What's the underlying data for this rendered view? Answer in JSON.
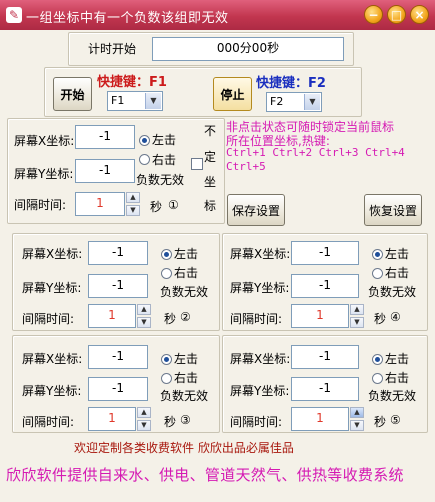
{
  "window": {
    "title": "一组坐标中有一个负数该组即无效",
    "app_icon": "✎",
    "minimize": "−",
    "maximize": "□",
    "close": "×"
  },
  "timer": {
    "label": "计时开始",
    "value": "000分00秒"
  },
  "controls": {
    "start_label": "开始",
    "start_hotkey_label": "快捷键：F1",
    "start_hotkey_value": "F1",
    "stop_label": "停止",
    "stop_hotkey_label": "快捷键：F2",
    "stop_hotkey_value": "F2"
  },
  "hint": {
    "line1": "非点击状态可随时锁定当前鼠标",
    "line2": "所在位置坐标,热键:",
    "line3": "Ctrl+1 Ctrl+2 Ctrl+3 Ctrl+4",
    "line4": "Ctrl+5"
  },
  "labels": {
    "x": "屏幕X坐标:",
    "y": "屏幕Y坐标:",
    "interval": "间隔时间:",
    "seconds": "秒",
    "left_click": "左击",
    "right_click": "右击",
    "negative_invalid": "负数无效",
    "fixed_vertical": [
      "不",
      "定",
      "坐",
      "标"
    ]
  },
  "groups": [
    {
      "x": "-1",
      "y": "-1",
      "interval": "1",
      "num": "①"
    },
    {
      "x": "-1",
      "y": "-1",
      "interval": "1",
      "num": "②"
    },
    {
      "x": "-1",
      "y": "-1",
      "interval": "1",
      "num": "③"
    },
    {
      "x": "-1",
      "y": "-1",
      "interval": "1",
      "num": "④"
    },
    {
      "x": "-1",
      "y": "-1",
      "interval": "1",
      "num": "⑤"
    }
  ],
  "buttons": {
    "save": "保存设置",
    "restore": "恢复设置"
  },
  "footer": {
    "slogan": "欢迎定制各类收费软件  欣欣出品必属佳品",
    "marquee": "欣欣软件提供自来水、供电、管道天然气、供热等收费系统"
  },
  "colors": {
    "accent_pink": "#d51ab3",
    "hotkey_red": "#cc1b1b",
    "hotkey_blue": "#1a2fbf",
    "title_bar": "#c2364f"
  }
}
